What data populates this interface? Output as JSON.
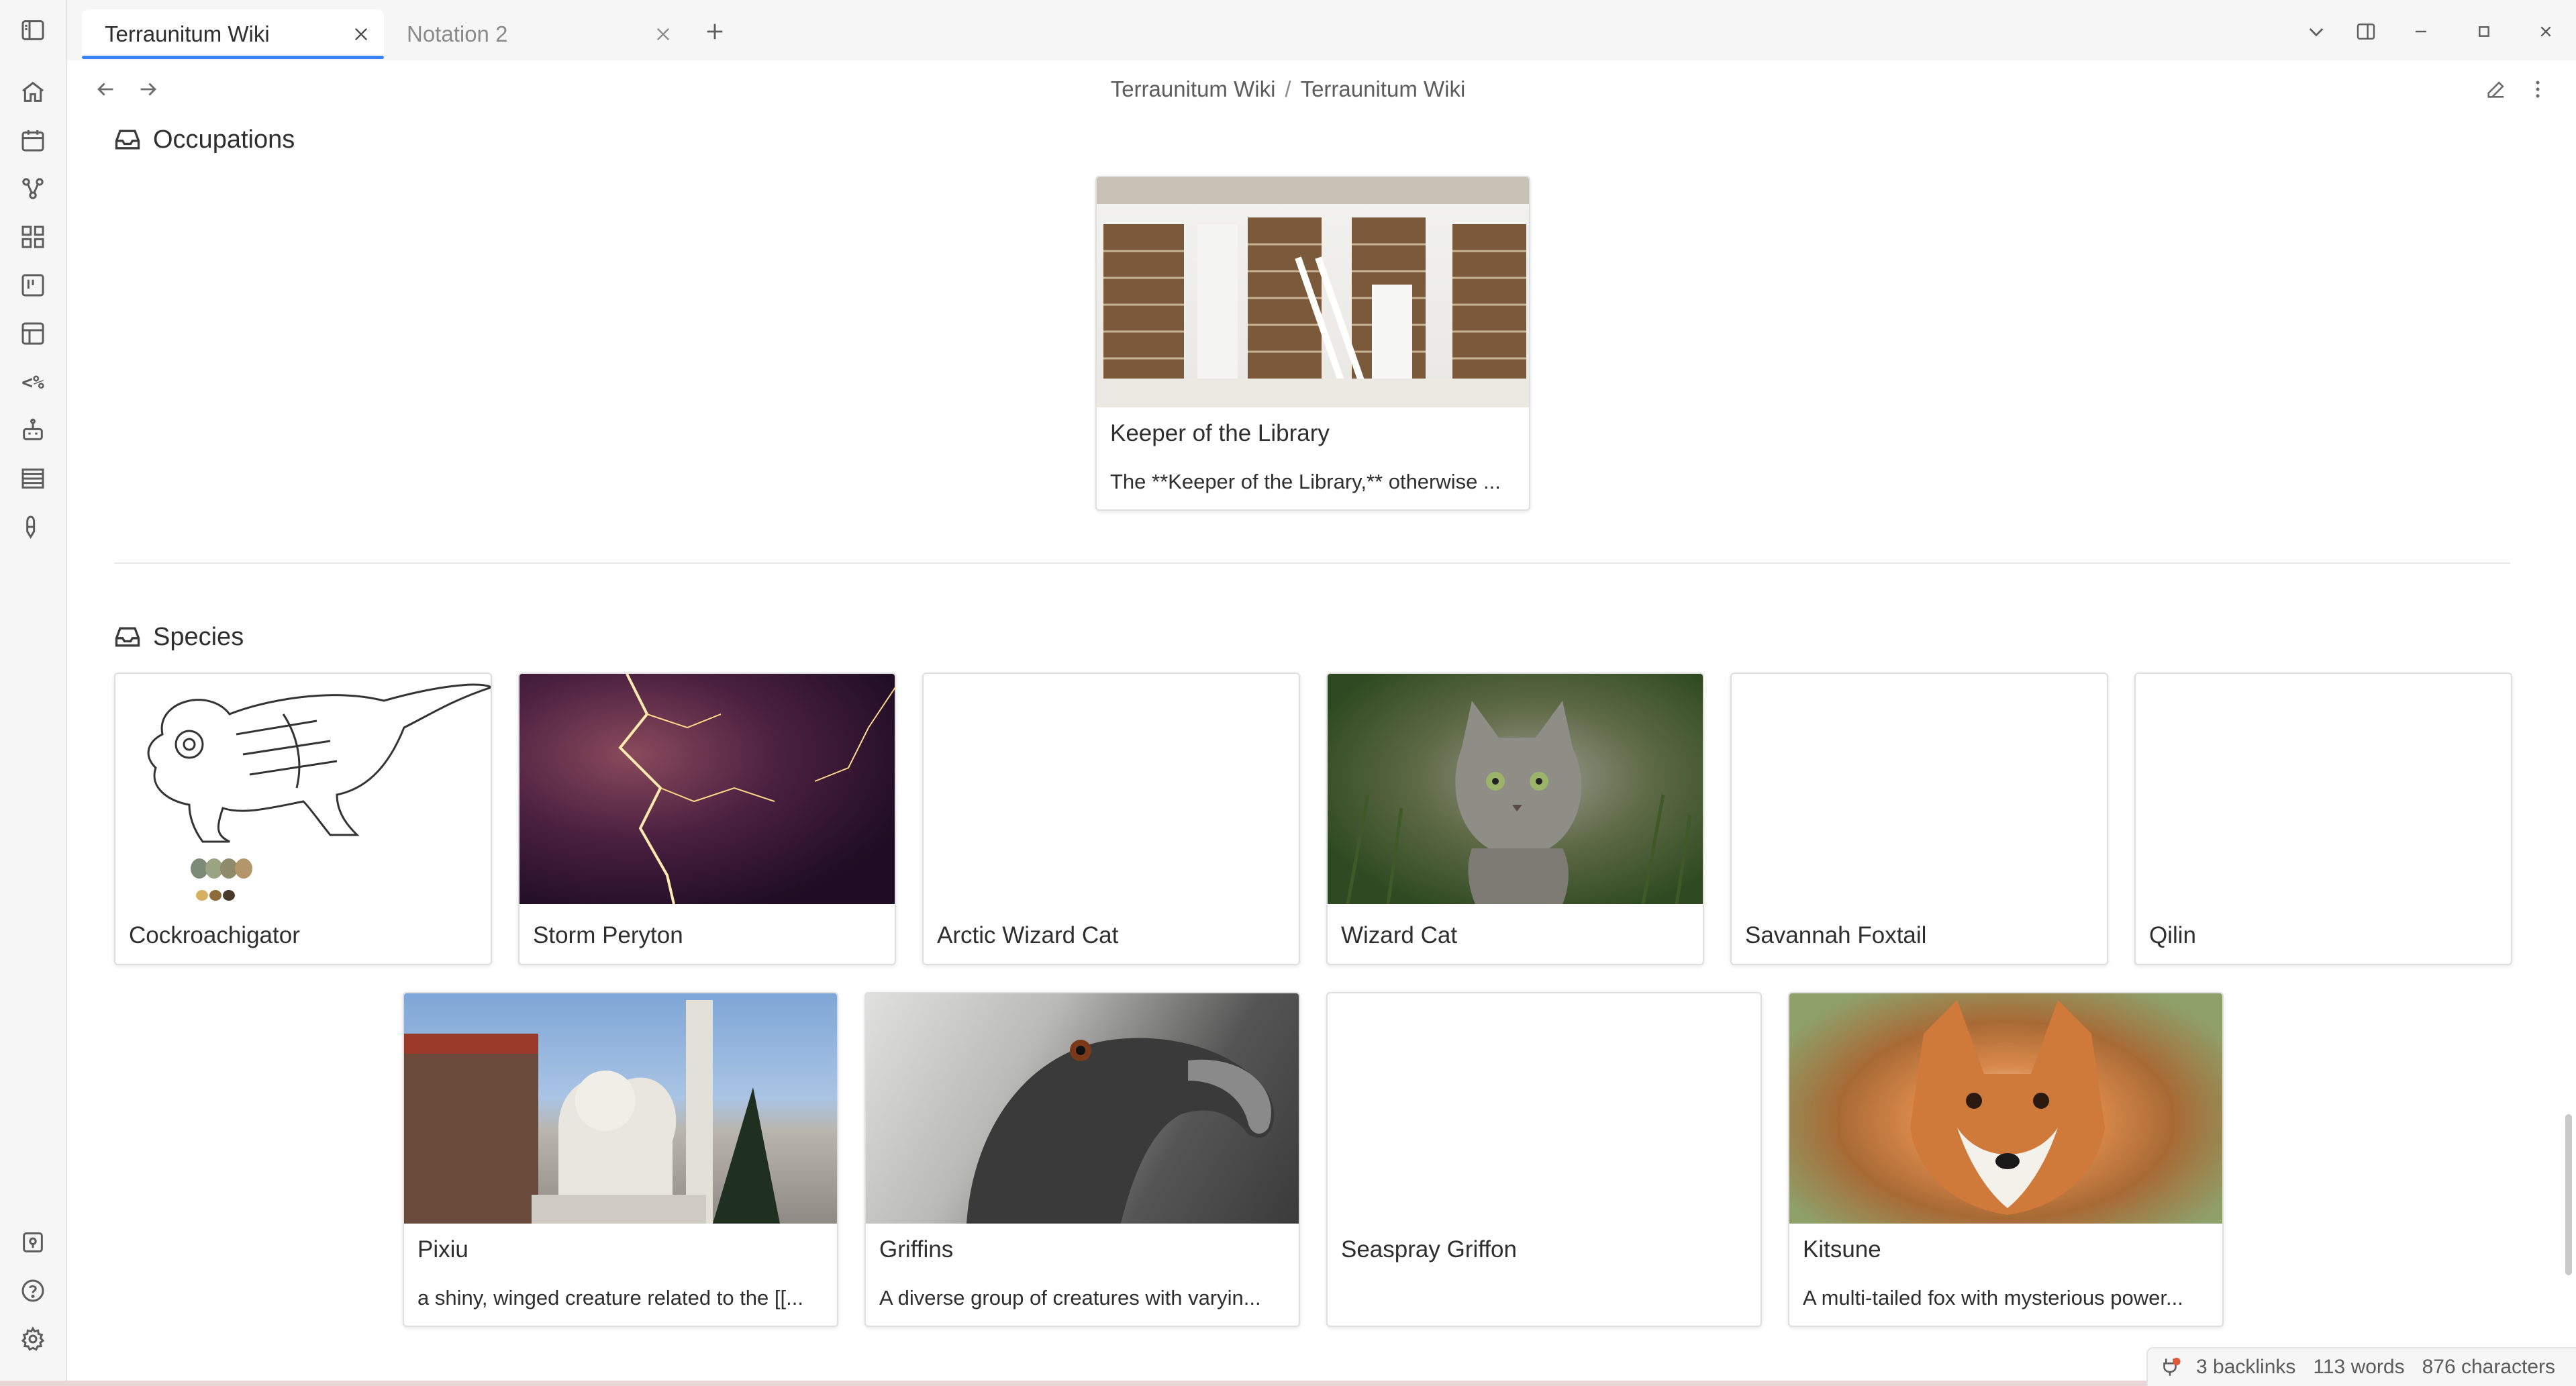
{
  "tabs": [
    {
      "label": "Terraunitum Wiki",
      "active": true
    },
    {
      "label": "Notation 2",
      "active": false
    }
  ],
  "breadcrumb": {
    "vault": "Terraunitum Wiki",
    "separator": "/",
    "note": "Terraunitum Wiki"
  },
  "ribbon": [
    "home-icon",
    "calendar-icon",
    "graph-icon",
    "dashboard-icon",
    "kanban-icon",
    "layout-icon",
    "templater-icon",
    "robot-icon",
    "list-icon",
    "pen-icon",
    "vault-icon",
    "help-icon",
    "settings-icon"
  ],
  "sections": {
    "occupations": {
      "title": "Occupations"
    },
    "species": {
      "title": "Species"
    }
  },
  "occupations": [
    {
      "title": "Keeper of the Library",
      "desc": "The **Keeper of the Library,** otherwise ...",
      "image": "library-interior"
    }
  ],
  "species": [
    {
      "title": "Cockroachigator",
      "image": "sketch"
    },
    {
      "title": "Storm Peryton",
      "image": "lightning-storm"
    },
    {
      "title": "Arctic Wizard Cat",
      "image": "none"
    },
    {
      "title": "Wizard Cat",
      "image": "tabby-cat"
    },
    {
      "title": "Savannah Foxtail",
      "image": "none"
    },
    {
      "title": "Qilin",
      "image": "none"
    },
    {
      "title": "Pixiu",
      "desc": "a shiny, winged creature related to the [[...",
      "image": "stone-lion-statue"
    },
    {
      "title": "Griffins",
      "desc": "A diverse group of creatures with varyin...",
      "image": "vulture-head"
    },
    {
      "title": "Seaspray Griffon",
      "image": "none"
    },
    {
      "title": "Kitsune",
      "desc": "A multi-tailed fox with mysterious power...",
      "image": "red-fox"
    }
  ],
  "statusbar": {
    "backlinks": "3 backlinks",
    "words": "113 words",
    "characters": "876 characters"
  },
  "colors": {
    "accent": "#3b82f6",
    "background": "#ffffff",
    "chrome": "#f6f6f6"
  }
}
